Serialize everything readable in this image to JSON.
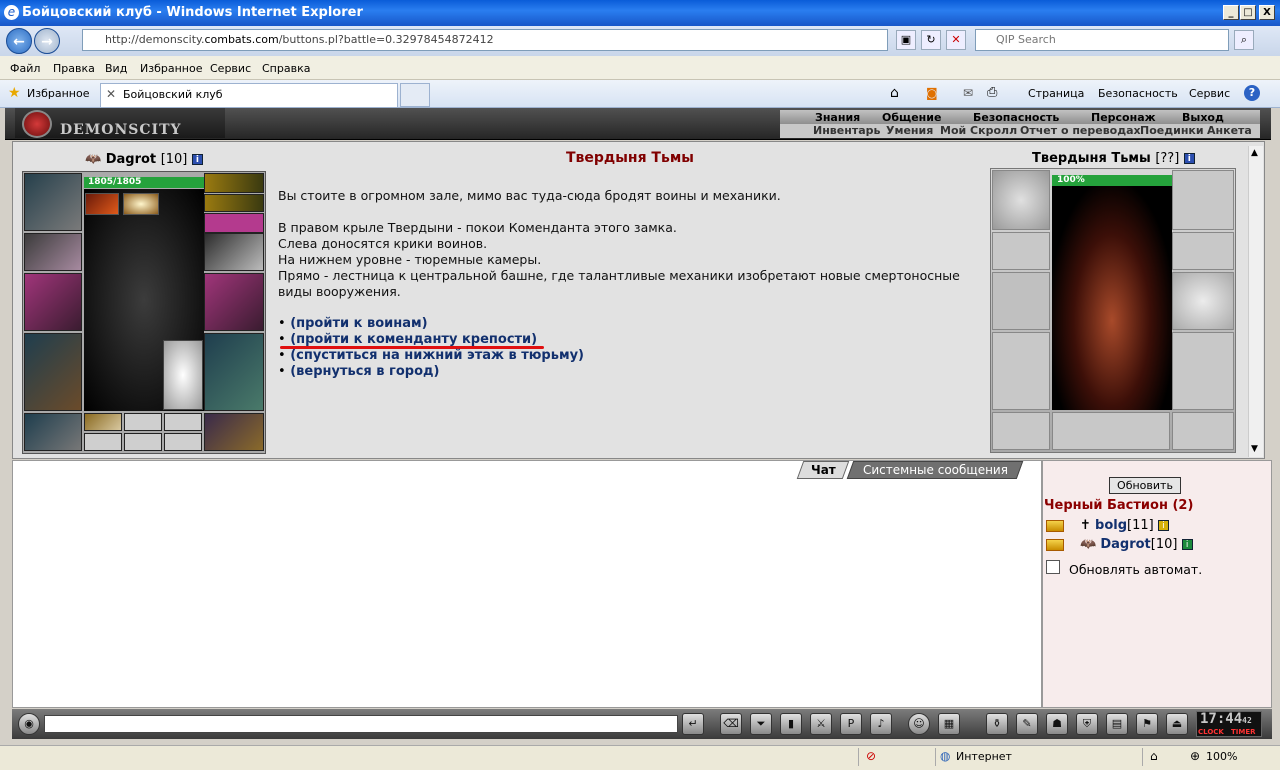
{
  "window": {
    "title": "Бойцовский клуб - Windows Internet Explorer",
    "min": "_",
    "max": "□",
    "close": "X"
  },
  "address": {
    "prefix": "http://demonscity.",
    "domain": "combats.com",
    "path": "/buttons.pl?battle=0.32978454872412"
  },
  "search": {
    "placeholder": "QIP Search"
  },
  "menu": [
    "Файл",
    "Правка",
    "Вид",
    "Избранное",
    "Сервис",
    "Справка"
  ],
  "favorites": {
    "label": "Избранное",
    "tab_title": "Бойцовский клуб"
  },
  "commands": {
    "page": "Страница",
    "security": "Безопасность",
    "service": "Сервис"
  },
  "game_header": {
    "logo": "DEMONSCITY",
    "top_menu": [
      "Знания",
      "Общение",
      "Безопасность",
      "Персонаж",
      "Выход"
    ],
    "sub_menu": [
      "Инвентарь",
      "Умения",
      "Мой Скролл",
      "Отчет о переводах",
      "Поединки",
      "Анкета"
    ]
  },
  "player": {
    "name": "Dagrot",
    "level": "[10]",
    "hp_text": "1805/1805",
    "hp_fraction": 1.0
  },
  "location": {
    "title": "Твердыня Тьмы",
    "lines": [
      "Вы стоите в огромном зале, мимо вас туда-сюда бродят воины и механики.",
      "В правом крыле Твердыни - покои Коменданта этого замка.",
      "Слева доносятся крики воинов.",
      "На нижнем уровне - тюремные камеры.",
      "Прямо - лестница к центральной башне, где талантливые механики изобретают новые смертоносные",
      "виды вооружения."
    ],
    "links": [
      "(пройти к воинам)",
      "(пройти к коменданту крепости)",
      "(спуститься на нижний этаж в тюрьму)",
      "(вернуться в город)"
    ],
    "bullet": "•"
  },
  "building": {
    "name": "Твердыня Тьмы",
    "level": "[??]",
    "hp_text": "100%",
    "hp_fraction": 1.0
  },
  "chat": {
    "tab_chat": "Чат",
    "tab_system": "Системные сообщения"
  },
  "room": {
    "refresh": "Обновить",
    "title": "Черный Бастион (2)",
    "players": [
      {
        "name": "bolg",
        "level": "[11]"
      },
      {
        "name": "Dagrot",
        "level": "[10]"
      }
    ],
    "auto_label": "Обновлять автомат."
  },
  "clock": {
    "time": "17:44",
    "seconds": "42",
    "clock_label": "CLOCK",
    "timer_label": "TIMER"
  },
  "status": {
    "zone": "Интернет",
    "zoom": "100%"
  }
}
